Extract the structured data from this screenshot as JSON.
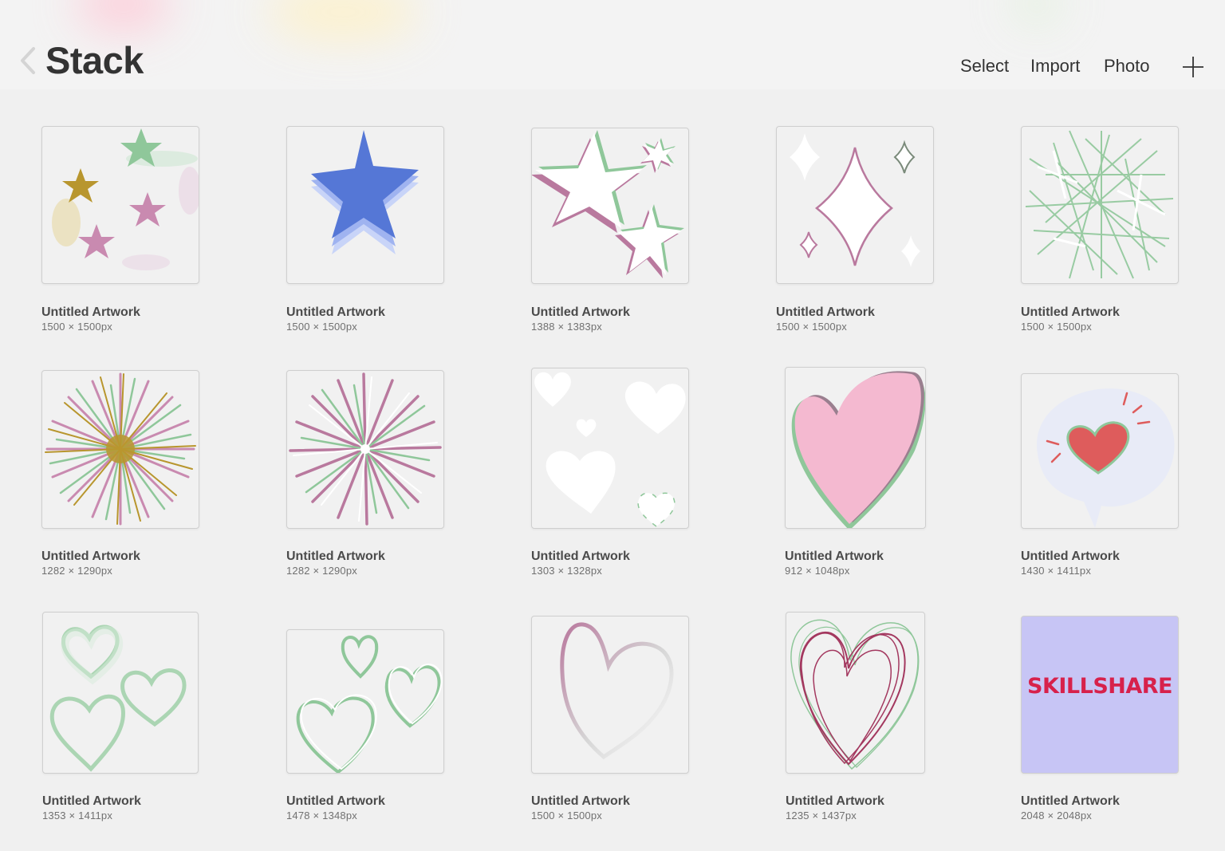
{
  "header": {
    "title": "Stack",
    "actions": {
      "select": "Select",
      "import": "Import",
      "photo": "Photo"
    }
  },
  "artworks": [
    {
      "title": "Untitled Artwork",
      "size": "1500 × 1500px"
    },
    {
      "title": "Untitled Artwork",
      "size": "1500 × 1500px"
    },
    {
      "title": "Untitled Artwork",
      "size": "1388 × 1383px"
    },
    {
      "title": "Untitled Artwork",
      "size": "1500 × 1500px"
    },
    {
      "title": "Untitled Artwork",
      "size": "1500 × 1500px"
    },
    {
      "title": "Untitled Artwork",
      "size": "1282 × 1290px"
    },
    {
      "title": "Untitled Artwork",
      "size": "1282 × 1290px"
    },
    {
      "title": "Untitled Artwork",
      "size": "1303 × 1328px"
    },
    {
      "title": "Untitled Artwork",
      "size": "912 × 1048px"
    },
    {
      "title": "Untitled Artwork",
      "size": "1430 × 1411px"
    },
    {
      "title": "Untitled Artwork",
      "size": "1353 × 1411px"
    },
    {
      "title": "Untitled Artwork",
      "size": "1478 × 1348px"
    },
    {
      "title": "Untitled Artwork",
      "size": "1500 × 1500px"
    },
    {
      "title": "Untitled Artwork",
      "size": "1235 × 1437px"
    },
    {
      "title": "Untitled Artwork",
      "size": "2048 × 2048px"
    }
  ],
  "logo_text": "SKILLSHARE",
  "colors": {
    "pink": "#b9799e",
    "green": "#8fc79a",
    "gold": "#b8962e",
    "blue": "#5577d6",
    "heart_pink": "#f4b9d0",
    "heart_red": "#de5c5c",
    "skillshare_bg": "#c7c5f5",
    "skillshare_text": "#d7214b"
  },
  "icons": [
    "chevron-left-icon",
    "plus-icon"
  ]
}
